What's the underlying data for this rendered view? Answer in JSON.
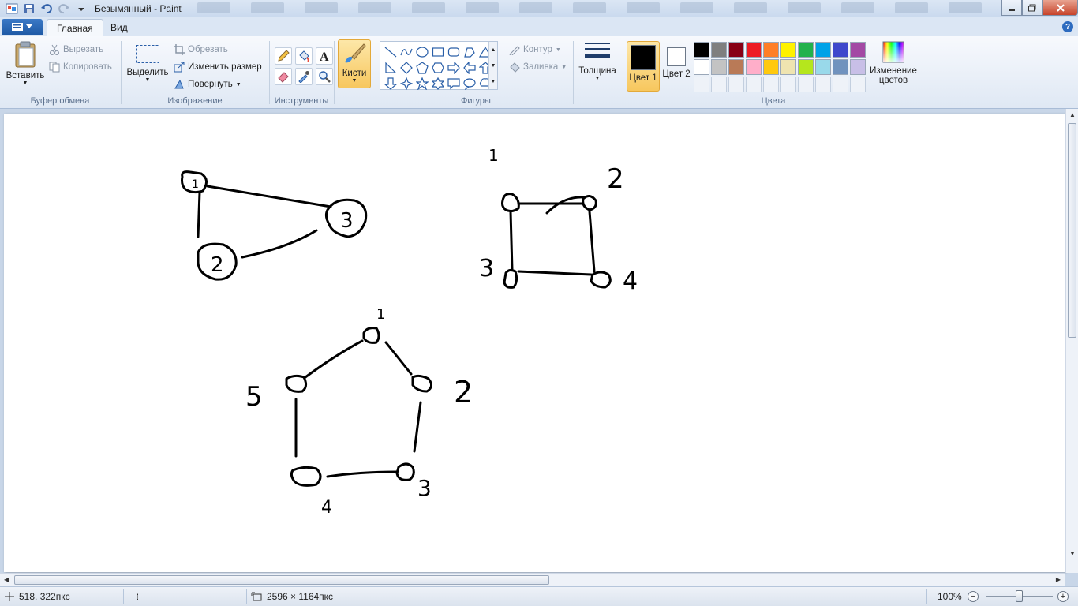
{
  "window": {
    "title": "Безымянный - Paint"
  },
  "tabs": [
    {
      "label": "Главная"
    },
    {
      "label": "Вид"
    }
  ],
  "clipboard": {
    "paste": "Вставить",
    "cut": "Вырезать",
    "copy": "Копировать",
    "group": "Буфер обмена"
  },
  "image": {
    "select": "Выделить",
    "crop": "Обрезать",
    "resize": "Изменить размер",
    "rotate": "Повернуть",
    "group": "Изображение"
  },
  "tools": {
    "group": "Инструменты"
  },
  "brushes": {
    "label": "Кисти"
  },
  "shapes": {
    "outline": "Контур",
    "fill": "Заливка",
    "group": "Фигуры"
  },
  "thickness": {
    "label": "Толщина"
  },
  "colors": {
    "color1": "Цвет 1",
    "color2": "Цвет 2",
    "edit": "Изменение цветов",
    "group": "Цвета",
    "palette": [
      "#000000",
      "#7f7f7f",
      "#880015",
      "#ed1c24",
      "#ff7f27",
      "#fff200",
      "#22b14c",
      "#00a2e8",
      "#3f48cc",
      "#a349a4",
      "#ffffff",
      "#c3c3c3",
      "#b97a57",
      "#ffaec9",
      "#ffc90e",
      "#efe4b0",
      "#b5e61d",
      "#99d9ea",
      "#7092be",
      "#c8bfe7"
    ],
    "primary": "#000000",
    "secondary": "#ffffff"
  },
  "canvas_labels": {
    "g1": [
      "1",
      "3",
      "2"
    ],
    "g2": [
      "1",
      "2",
      "3",
      "4"
    ],
    "g3": [
      "1",
      "2",
      "3",
      "4",
      "5"
    ]
  },
  "status": {
    "cursor": "518, 322пкс",
    "size": "2596 × 1164пкс",
    "zoom": "100%"
  }
}
